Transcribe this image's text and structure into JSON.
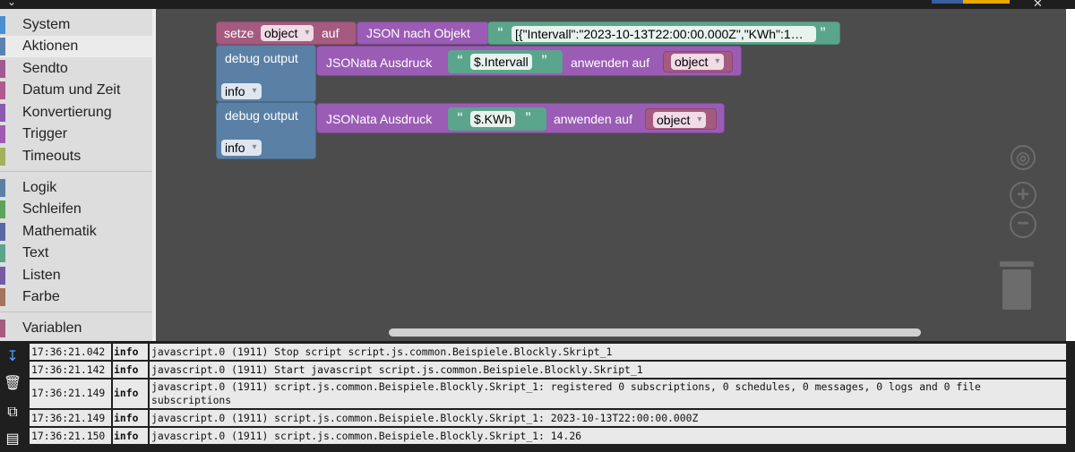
{
  "toolbox": {
    "categories": [
      {
        "label": "System",
        "color": "#4a8fcf"
      },
      {
        "label": "Aktionen",
        "color": "#5a82b0"
      },
      {
        "label": "Sendto",
        "color": "#a05a8f"
      },
      {
        "label": "Datum und Zeit",
        "color": "#b05a8f"
      },
      {
        "label": "Konvertierung",
        "color": "#8a5ab0"
      },
      {
        "label": "Trigger",
        "color": "#a05ab0"
      },
      {
        "label": "Timeouts",
        "color": "#a5b05a"
      },
      {
        "label": "Logik",
        "color": "#5b80a5"
      },
      {
        "label": "Schleifen",
        "color": "#5ba55b"
      },
      {
        "label": "Mathematik",
        "color": "#5b67a5"
      },
      {
        "label": "Text",
        "color": "#5ba58c"
      },
      {
        "label": "Listen",
        "color": "#745ba5"
      },
      {
        "label": "Farbe",
        "color": "#a5745b"
      },
      {
        "label": "Variablen",
        "color": "#a55b80"
      }
    ]
  },
  "blocks": {
    "set": {
      "label_set": "setze",
      "var": "object",
      "label_to": "auf"
    },
    "json": {
      "label": "JSON nach Objekt",
      "text": "[{\"Intervall\":\"2023-10-13T22:00:00.000Z\",\"KWh\":1…"
    },
    "debug1": {
      "label": "debug output",
      "level": "info",
      "jsonata": "JSONata Ausdruck",
      "expr": "$.Intervall",
      "apply": "anwenden auf",
      "var": "object"
    },
    "debug2": {
      "label": "debug output",
      "level": "info",
      "jsonata": "JSONata Ausdruck",
      "expr": "$.KWh",
      "apply": "anwenden auf",
      "var": "object"
    }
  },
  "log": {
    "rows": [
      {
        "time": "17:36:21.042",
        "level": "info",
        "msg": "javascript.0 (1911) Stop script script.js.common.Beispiele.Blockly.Skript_1"
      },
      {
        "time": "17:36:21.142",
        "level": "info",
        "msg": "javascript.0 (1911) Start javascript script.js.common.Beispiele.Blockly.Skript_1"
      },
      {
        "time": "17:36:21.149",
        "level": "info",
        "msg": "javascript.0 (1911) script.js.common.Beispiele.Blockly.Skript_1: registered 0 subscriptions, 0 schedules, 0 messages, 0 logs and 0 file subscriptions"
      },
      {
        "time": "17:36:21.149",
        "level": "info",
        "msg": "javascript.0 (1911) script.js.common.Beispiele.Blockly.Skript_1: 2023-10-13T22:00:00.000Z"
      },
      {
        "time": "17:36:21.150",
        "level": "info",
        "msg": "javascript.0 (1911) script.js.common.Beispiele.Blockly.Skript_1: 14.26"
      }
    ]
  },
  "icons": {
    "top_menu": "chevron-down-icon",
    "top_close": "close-icon",
    "center": "target-icon",
    "zoom_in": "zoom-in-icon",
    "zoom_out": "zoom-out-icon",
    "trash": "trash-icon",
    "log_scroll": "scroll-down-icon",
    "log_clear": "clear-log-icon",
    "log_copy": "copy-icon",
    "log_menu": "menu-icon"
  }
}
